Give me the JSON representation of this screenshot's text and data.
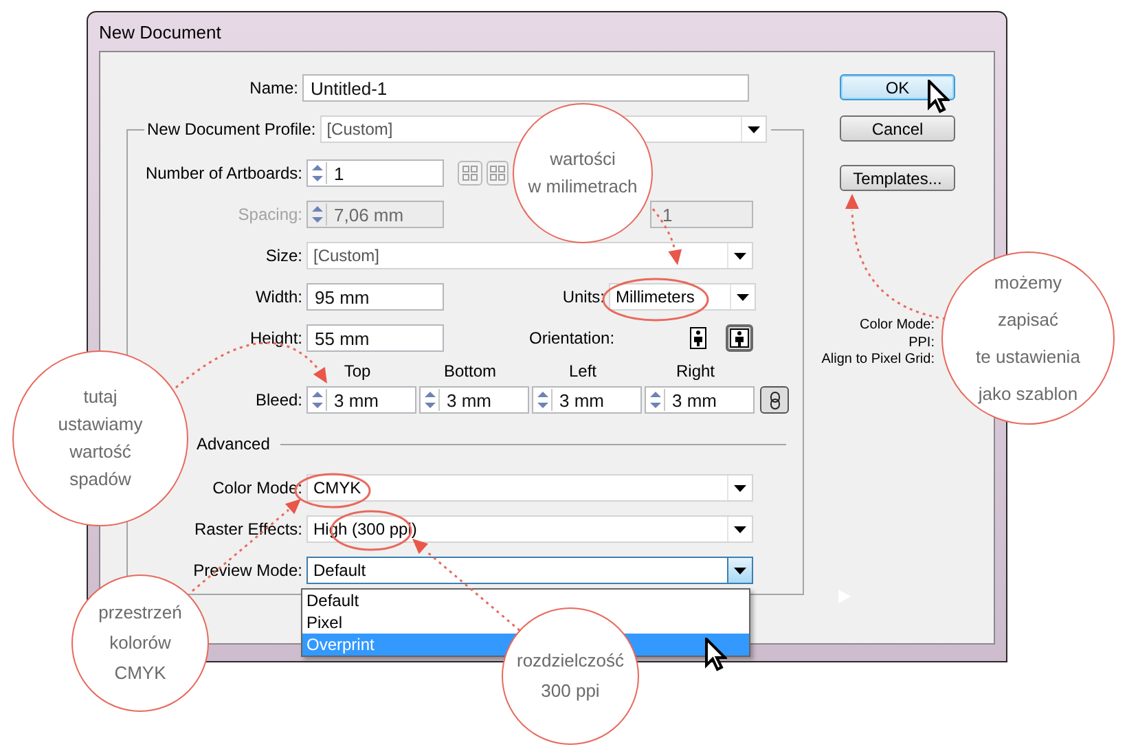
{
  "window": {
    "title": "New Document"
  },
  "name": {
    "label": "Name:",
    "value": "Untitled-1"
  },
  "profile": {
    "label": "New Document Profile:",
    "value": "[Custom]"
  },
  "artboards": {
    "label": "Number of Artboards:",
    "value": "1"
  },
  "spacing": {
    "label": "Spacing:",
    "value": "7,06 mm",
    "disabled": true
  },
  "columns": {
    "value": "1",
    "disabled": true
  },
  "size": {
    "label": "Size:",
    "value": "[Custom]"
  },
  "width": {
    "label": "Width:",
    "value": "95 mm"
  },
  "units": {
    "label": "Units:",
    "value": "Millimeters"
  },
  "height": {
    "label": "Height:",
    "value": "55 mm"
  },
  "orientation": {
    "label": "Orientation:",
    "options": [
      {
        "kind": "portrait",
        "selected": false
      },
      {
        "kind": "landscape",
        "selected": true
      }
    ]
  },
  "bleed": {
    "label": "Bleed:",
    "sides": [
      {
        "label": "Top",
        "value": "3 mm"
      },
      {
        "label": "Bottom",
        "value": "3 mm"
      },
      {
        "label": "Left",
        "value": "3 mm"
      },
      {
        "label": "Right",
        "value": "3 mm"
      }
    ]
  },
  "advanced": {
    "label": "Advanced"
  },
  "color_mode": {
    "label": "Color Mode:",
    "value": "CMYK"
  },
  "raster_effects": {
    "label": "Raster Effects:",
    "value": "High (300 ppi)"
  },
  "preview_mode": {
    "label": "Preview Mode:",
    "value": "Default",
    "expanded": true,
    "options": [
      {
        "label": "Default",
        "highlighted": false
      },
      {
        "label": "Pixel",
        "highlighted": false
      },
      {
        "label": "Overprint",
        "highlighted": true
      }
    ]
  },
  "buttons": [
    {
      "label": "OK",
      "default": true
    },
    {
      "label": "Cancel",
      "default": false
    },
    {
      "label": "Templates...",
      "default": false
    }
  ],
  "info": [
    "Color Mode:",
    "PPI:",
    "Align to Pixel Grid:"
  ],
  "annotations": [
    {
      "text": "wartości\nw milimetrach"
    },
    {
      "text": "możemy\nzapisać\nte ustawienia\njako szablon"
    },
    {
      "text": "tutaj\nustawiamy\nwartość\nspadów"
    },
    {
      "text": "przestrzeń\nkolorów\nCMYK"
    },
    {
      "text": "rozdzielczość\n300 ppi"
    }
  ]
}
